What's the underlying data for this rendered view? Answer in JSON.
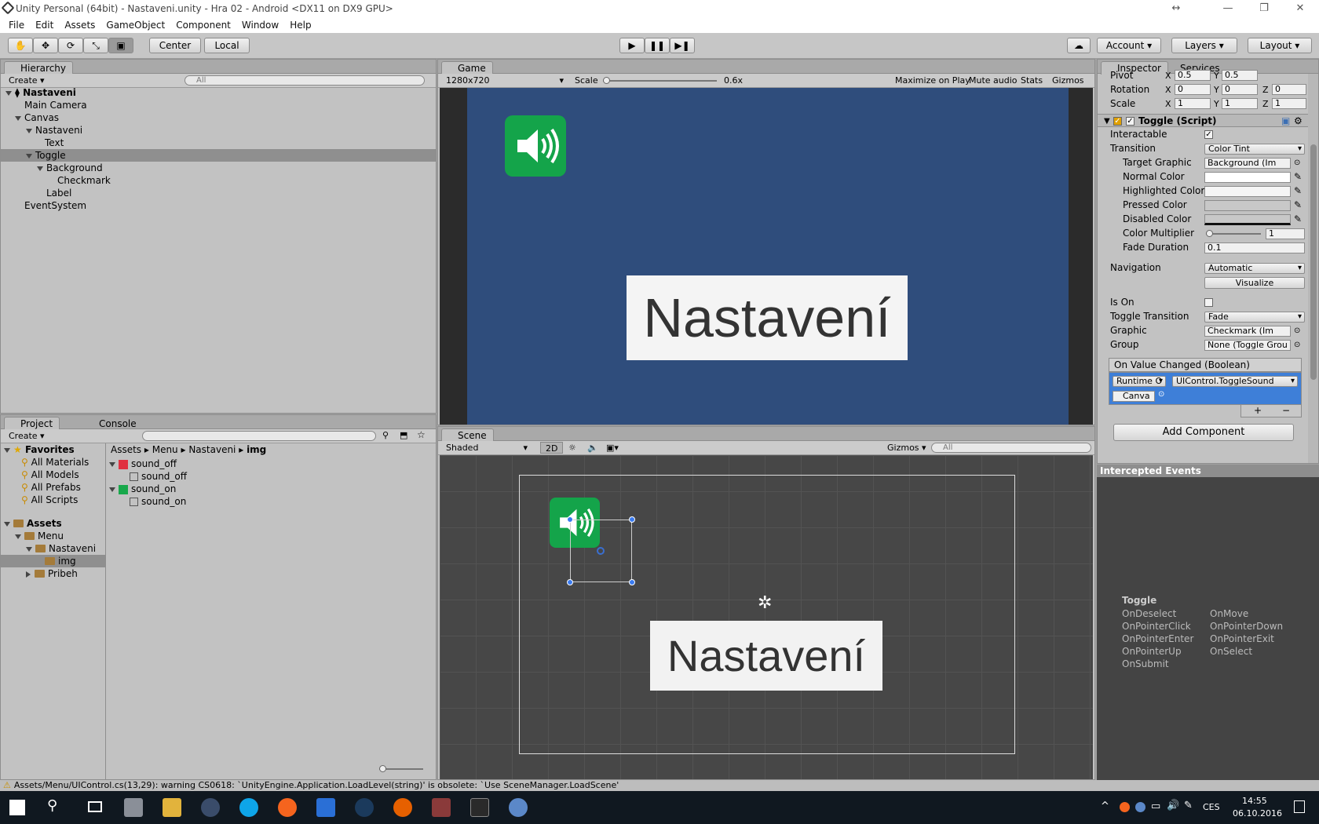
{
  "window": {
    "title": "Unity Personal (64bit) - Nastaveni.unity - Hra 02 - Android <DX11 on DX9 GPU>"
  },
  "menu": [
    "File",
    "Edit",
    "Assets",
    "GameObject",
    "Component",
    "Window",
    "Help"
  ],
  "toolbar": {
    "center_label": "Center",
    "local_label": "Local",
    "account_label": "Account",
    "layers_label": "Layers",
    "layout_label": "Layout"
  },
  "hierarchy": {
    "tab": "Hierarchy",
    "create": "Create",
    "search_placeholder": "All",
    "scene": "Nastaveni",
    "items": [
      "Main Camera",
      "Canvas",
      "Nastaveni",
      "Text",
      "Toggle",
      "Background",
      "Checkmark",
      "Label",
      "EventSystem"
    ]
  },
  "game": {
    "tab": "Game",
    "resolution": "1280x720",
    "scale_label": "Scale",
    "scale_value": "0.6x",
    "options": [
      "Maximize on Play",
      "Mute audio",
      "Stats",
      "Gizmos"
    ],
    "button_text": "Nastavení",
    "bg_color": "#2f4d7c",
    "icon_color": "#14a44a"
  },
  "project": {
    "tab": "Project",
    "console_tab": "Console",
    "create": "Create",
    "favorites_label": "Favorites",
    "favorites": [
      "All Materials",
      "All Models",
      "All Prefabs",
      "All Scripts"
    ],
    "assets_label": "Assets",
    "tree": [
      "Menu",
      "Nastaveni",
      "img",
      "Pribeh"
    ],
    "breadcrumb": [
      "Assets",
      "Menu",
      "Nastaveni",
      "img"
    ],
    "files": [
      "sound_off",
      "sound_off",
      "sound_on",
      "sound_on"
    ]
  },
  "scene": {
    "tab": "Scene",
    "shading": "Shaded",
    "mode_2d": "2D",
    "gizmos": "Gizmos",
    "search_placeholder": "All",
    "button_text": "Nastavení"
  },
  "inspector": {
    "tab": "Inspector",
    "services_tab": "Services",
    "pivot": {
      "label": "Pivot",
      "x": "0.5",
      "y": "0.5"
    },
    "rotation": {
      "label": "Rotation",
      "x": "0",
      "y": "0",
      "z": "0"
    },
    "scale": {
      "label": "Scale",
      "x": "1",
      "y": "1",
      "z": "1"
    },
    "component_title": "Toggle (Script)",
    "interactable_label": "Interactable",
    "transition_label": "Transition",
    "transition_value": "Color Tint",
    "target_graphic_label": "Target Graphic",
    "target_graphic_value": "Background (Im",
    "normal_color_label": "Normal Color",
    "highlighted_color_label": "Highlighted Color",
    "pressed_color_label": "Pressed Color",
    "disabled_color_label": "Disabled Color",
    "color_multiplier_label": "Color Multiplier",
    "color_multiplier_value": "1",
    "fade_duration_label": "Fade Duration",
    "fade_duration_value": "0.1",
    "navigation_label": "Navigation",
    "navigation_value": "Automatic",
    "visualize_label": "Visualize",
    "is_on_label": "Is On",
    "toggle_transition_label": "Toggle Transition",
    "toggle_transition_value": "Fade",
    "graphic_label": "Graphic",
    "graphic_value": "Checkmark (Im",
    "group_label": "Group",
    "group_value": "None (Toggle Grou",
    "event_header": "On Value Changed (Boolean)",
    "runtime_value": "Runtime O",
    "function_value": "UIControl.ToggleSound",
    "object_value": "Canva",
    "plus": "+",
    "minus": "−",
    "add_component": "Add Component"
  },
  "intercepted": {
    "title": "Intercepted Events",
    "component": "Toggle",
    "left_events": [
      "OnDeselect",
      "OnPointerClick",
      "OnPointerEnter",
      "OnPointerUp",
      "OnSubmit"
    ],
    "right_events": [
      "OnMove",
      "OnPointerDown",
      "OnPointerExit",
      "OnSelect"
    ]
  },
  "status": {
    "message": "Assets/Menu/UIControl.cs(13,29): warning CS0618: `UnityEngine.Application.LoadLevel(string)' is obsolete: `Use SceneManager.LoadScene'"
  },
  "taskbar": {
    "lang": "CES",
    "time": "14:55",
    "date": "06.10.2016"
  }
}
